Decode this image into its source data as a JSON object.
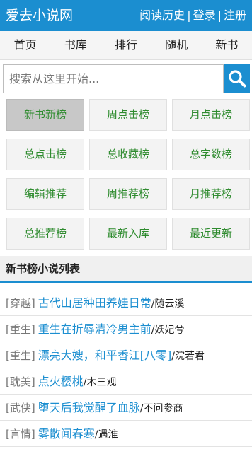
{
  "header": {
    "site_title": "爱去小说网",
    "links": [
      "阅读历史",
      "登录",
      "注册"
    ],
    "separator": "|"
  },
  "nav": {
    "items": [
      "首页",
      "书库",
      "排行",
      "随机",
      "新书"
    ]
  },
  "search": {
    "placeholder": "搜索从这里开始...",
    "button_icon": "search-icon"
  },
  "rankings": {
    "items": [
      "新书新榜",
      "周点击榜",
      "月点击榜",
      "总点击榜",
      "总收藏榜",
      "总字数榜",
      "编辑推荐",
      "周推荐榜",
      "月推荐榜",
      "总推荐榜",
      "最新入库",
      "最近更新"
    ],
    "active_index": 0
  },
  "list": {
    "heading": "新书榜小说列表",
    "books": [
      {
        "category": "[穿越]",
        "title": "古代山居种田养娃日常",
        "author": "/随云溪"
      },
      {
        "category": "[重生]",
        "title": "重生在折辱清冷男主前",
        "author": "/妖妃兮"
      },
      {
        "category": "[重生]",
        "title": "漂亮大嫂，和平香江[八零]",
        "author": "/浣若君"
      },
      {
        "category": "[耽美]",
        "title": "点火樱桃",
        "author": "/木三观"
      },
      {
        "category": "[武侠]",
        "title": "堕天后我觉醒了血脉",
        "author": "/不问参商"
      },
      {
        "category": "[言情]",
        "title": "雾散闻春寒",
        "author": "/遇淮"
      }
    ]
  },
  "colors": {
    "brand_blue": "#1b8ed0",
    "ranking_green": "#2e8b2e",
    "active_cell": "#c8c8c8"
  }
}
